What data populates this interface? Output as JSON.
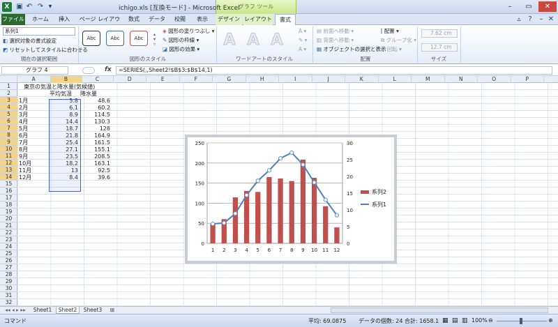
{
  "window": {
    "title": "ichigo.xls [互換モード] - Microsoft Excel",
    "contextual_title": "グラフ ツール"
  },
  "tabs": [
    "ファイル",
    "ホーム",
    "挿入",
    "ページ レイアウト",
    "数式",
    "データ",
    "校閲",
    "表示",
    "デザイン",
    "レイアウト",
    "書式"
  ],
  "ribbon": {
    "selection_box": "系列1",
    "format_selection": "選択対象の書式設定",
    "reset_style": "リセットしてスタイルに合わせる",
    "current_selection_group": "現在の選択範囲",
    "shape_style_labels": [
      "Abc",
      "Abc",
      "Abc"
    ],
    "shape_fill": "図形の塗りつぶし",
    "shape_outline": "図形の枠線",
    "shape_effects": "図形の効果",
    "shape_styles_group": "図形のスタイル",
    "wordart_glyph": "A",
    "wordart_group": "ワードアートのスタイル",
    "bring_forward": "前面へ移動",
    "send_backward": "背面へ移動",
    "selection_pane": "オブジェクトの選択と表示",
    "align": "配置",
    "group": "グループ化",
    "rotate": "回転",
    "arrange_group": "配置",
    "height": "7.62 cm",
    "width": "12.7 cm",
    "size_group": "サイズ"
  },
  "formula_bar": {
    "name_box": "グラフ 4",
    "fx": "fx",
    "formula": "=SERIES(,,Sheet2!$B$3:$B$14,1)"
  },
  "columns": [
    "A",
    "B",
    "C",
    "D",
    "E",
    "F",
    "G",
    "H",
    "I",
    "J",
    "K",
    "L",
    "M",
    "N",
    "O",
    "P",
    "Q"
  ],
  "rows": [
    "1",
    "2",
    "3",
    "4",
    "5",
    "6",
    "7",
    "8",
    "9",
    "10",
    "11",
    "12",
    "13",
    "14",
    "15",
    "16",
    "17",
    "18",
    "19",
    "20",
    "21",
    "22",
    "23",
    "24",
    "25",
    "26",
    "27",
    "28",
    "29",
    "30",
    "31",
    "32"
  ],
  "sheet": {
    "title": "東京の気温と降水量(気候値)",
    "header_temp": "平均気温",
    "header_rain": "降水量",
    "months": [
      "1月",
      "2月",
      "3月",
      "4月",
      "5月",
      "6月",
      "7月",
      "8月",
      "9月",
      "10月",
      "11月",
      "12月"
    ],
    "temps": [
      "5.8",
      "6.1",
      "8.9",
      "14.4",
      "18.7",
      "21.8",
      "25.4",
      "27.1",
      "23.5",
      "18.2",
      "13",
      "8.4"
    ],
    "rain": [
      "48.6",
      "60.2",
      "114.5",
      "130.3",
      "128",
      "164.9",
      "161.5",
      "155.1",
      "208.5",
      "163.1",
      "92.5",
      "39.6"
    ]
  },
  "chart_data": {
    "type": "bar",
    "categories": [
      "1",
      "2",
      "3",
      "4",
      "5",
      "6",
      "7",
      "8",
      "9",
      "10",
      "11",
      "12"
    ],
    "y_left_ticks": [
      "0",
      "50",
      "100",
      "150",
      "200",
      "250"
    ],
    "y_right_ticks": [
      "0",
      "5",
      "10",
      "15",
      "20",
      "25",
      "30"
    ],
    "ylim_left": [
      0,
      250
    ],
    "ylim_right": [
      0,
      30
    ],
    "series": [
      {
        "name": "系列2",
        "type": "bar",
        "axis": "left",
        "color": "#c0504d",
        "values": [
          48.6,
          60.2,
          114.5,
          130.3,
          128,
          164.9,
          161.5,
          155.1,
          208.5,
          163.1,
          92.5,
          39.6
        ]
      },
      {
        "name": "系列1",
        "type": "line",
        "axis": "right",
        "color": "#4f81bd",
        "values": [
          5.8,
          6.1,
          8.9,
          14.4,
          18.7,
          21.8,
          25.4,
          27.1,
          23.5,
          18.2,
          13,
          8.4
        ]
      }
    ],
    "legend_position": "right",
    "grid": true
  },
  "sheet_tabs": [
    "Sheet1",
    "Sheet2",
    "Sheet3"
  ],
  "status": {
    "mode": "コマンド",
    "average": "平均: 69.0875",
    "count": "データの個数: 24",
    "sum": "合計: 1658.1",
    "zoom": "100%"
  }
}
